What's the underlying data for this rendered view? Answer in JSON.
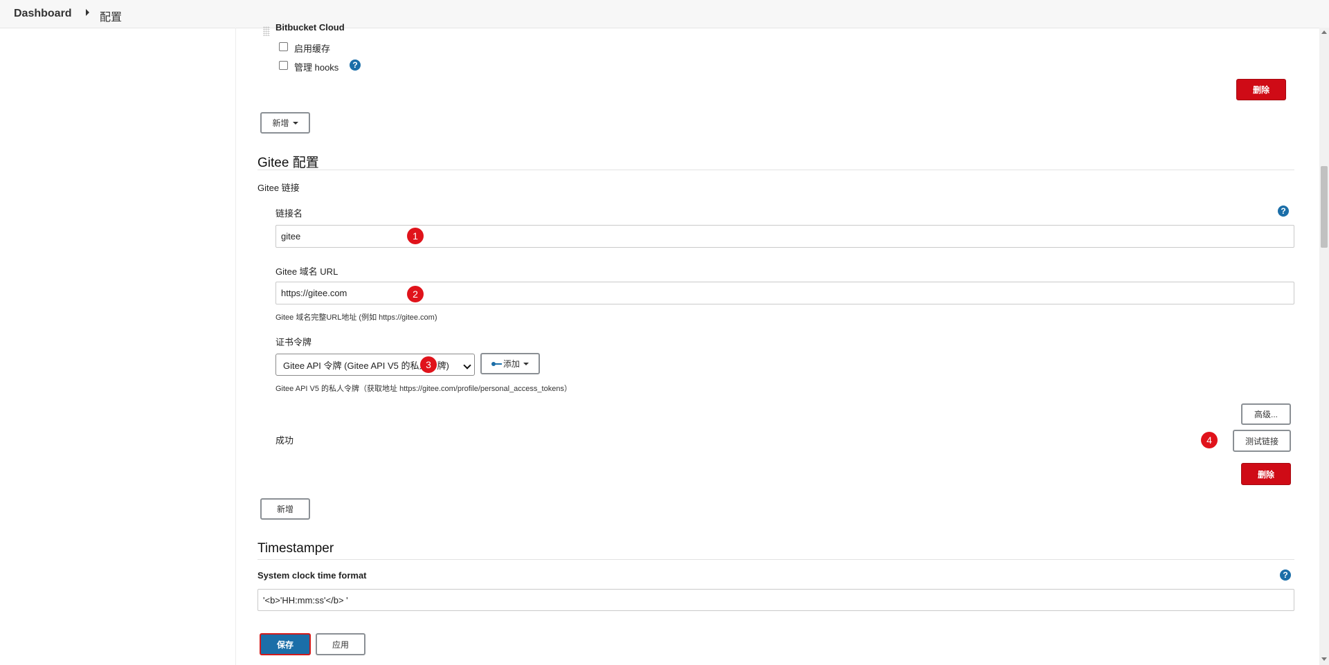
{
  "breadcrumb": {
    "dashboard": "Dashboard",
    "current": "配置"
  },
  "bitbucket": {
    "title": "Bitbucket Cloud",
    "enable_cache_label": "启用缓存",
    "manage_hooks_label": "管理 hooks",
    "delete_label": "删除",
    "add_label": "新增"
  },
  "gitee": {
    "section_title": "Gitee 配置",
    "connections_label": "Gitee 链接",
    "name_label": "链接名",
    "name_value": "gitee",
    "url_label": "Gitee 域名 URL",
    "url_value": "https://gitee.com",
    "url_hint": "Gitee 域名完整URL地址 (例如 https://gitee.com)",
    "credential_label": "证书令牌",
    "credential_selected": "Gitee API 令牌 (Gitee API V5 的私人令牌)",
    "credential_add_label": "添加",
    "credential_hint": "Gitee API V5 的私人令牌（获取地址 https://gitee.com/profile/personal_access_tokens）",
    "advanced_label": "高级...",
    "status_text": "成功",
    "test_label": "测试链接",
    "delete_label": "删除",
    "add_label": "新增"
  },
  "timestamper": {
    "section_title": "Timestamper",
    "format_label": "System clock time format",
    "format_value": "'<b>'HH:mm:ss'</b> '"
  },
  "actions": {
    "save_label": "保存",
    "apply_label": "应用"
  },
  "markers": [
    "1",
    "2",
    "3",
    "4"
  ],
  "colors": {
    "primary": "#1b6ea8",
    "danger": "#cf0b16",
    "marker": "#e0131b"
  }
}
